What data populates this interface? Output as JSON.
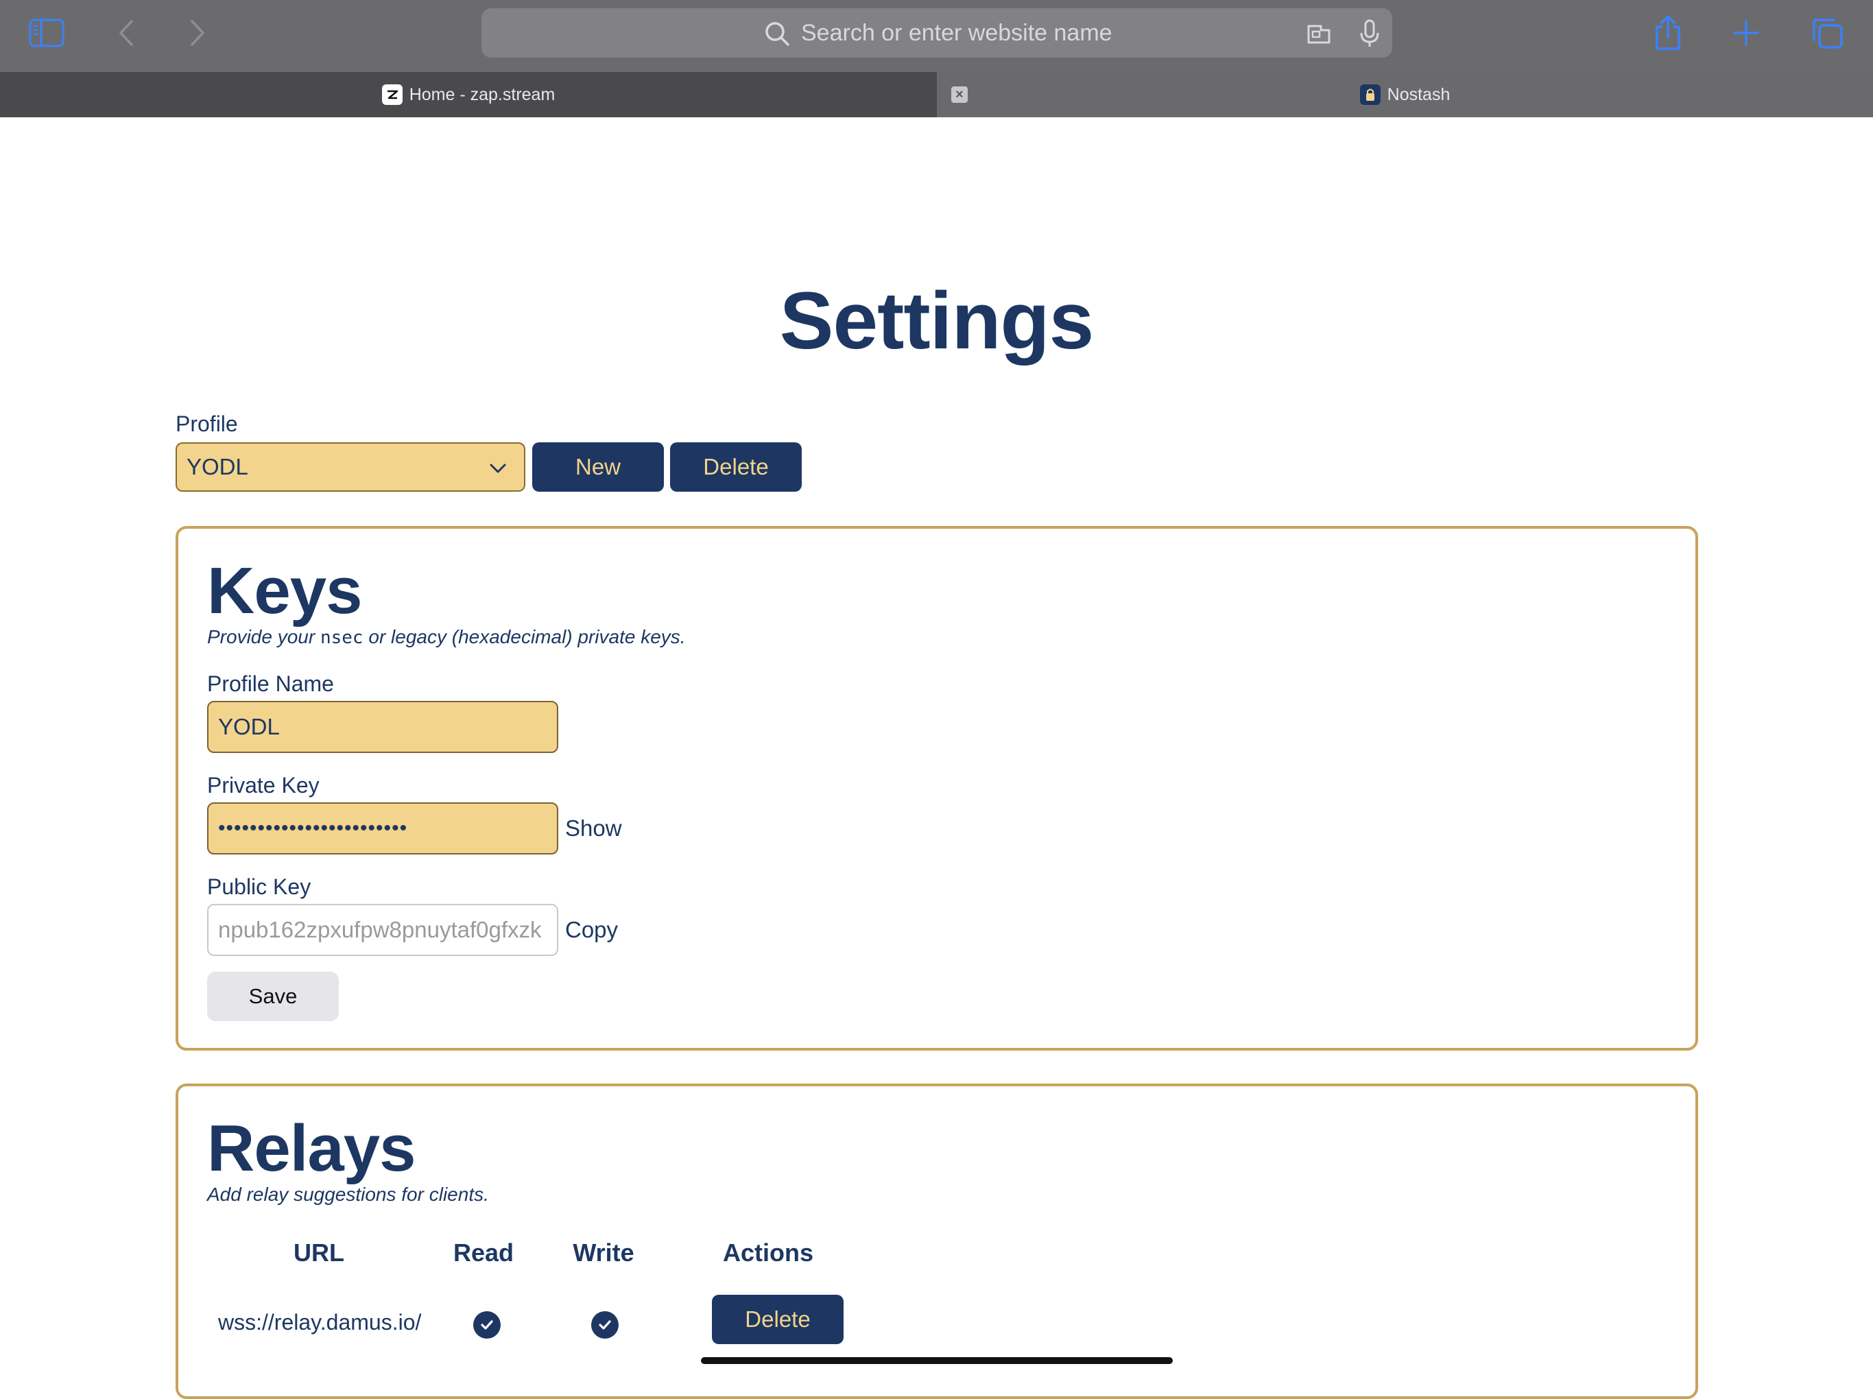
{
  "browser": {
    "url_placeholder": "Search or enter website name",
    "tabs": [
      {
        "label": "Home - zap.stream",
        "active": true,
        "favicon": "zap-stream-icon"
      },
      {
        "label": "Nostash",
        "active": false,
        "favicon": "nostash-icon"
      }
    ],
    "icons": [
      "sidebar-icon",
      "back-icon",
      "forward-icon",
      "search-icon",
      "extension-icon",
      "microphone-icon",
      "share-icon",
      "new-tab-icon",
      "tabs-overview-icon",
      "tab-close-icon"
    ]
  },
  "page": {
    "title": "Settings",
    "profile": {
      "label": "Profile",
      "selected": "YODL",
      "new_label": "New",
      "delete_label": "Delete"
    },
    "keys": {
      "title": "Keys",
      "subtitle_before": "Provide your ",
      "subtitle_code": "nsec",
      "subtitle_after": " or legacy (hexadecimal) private keys.",
      "profile_name_label": "Profile Name",
      "profile_name_value": "YODL",
      "private_key_label": "Private Key",
      "private_key_value": "••••••••••••••••••••••••",
      "show_label": "Show",
      "public_key_label": "Public Key",
      "public_key_value": "npub162zpxufpw8pnuytaf0gfxzk",
      "copy_label": "Copy",
      "save_label": "Save"
    },
    "relays": {
      "title": "Relays",
      "subtitle": "Add relay suggestions for clients.",
      "columns": [
        "URL",
        "Read",
        "Write",
        "Actions"
      ],
      "rows": [
        {
          "url": "wss://relay.damus.io/",
          "read": true,
          "write": true,
          "action_label": "Delete"
        }
      ]
    }
  },
  "colors": {
    "navy": "#1d3762",
    "gold_fill": "#f3d48c",
    "card_border": "#c8a35a",
    "chrome": "#6b6b6e",
    "accent_blue": "#3b82f6"
  }
}
